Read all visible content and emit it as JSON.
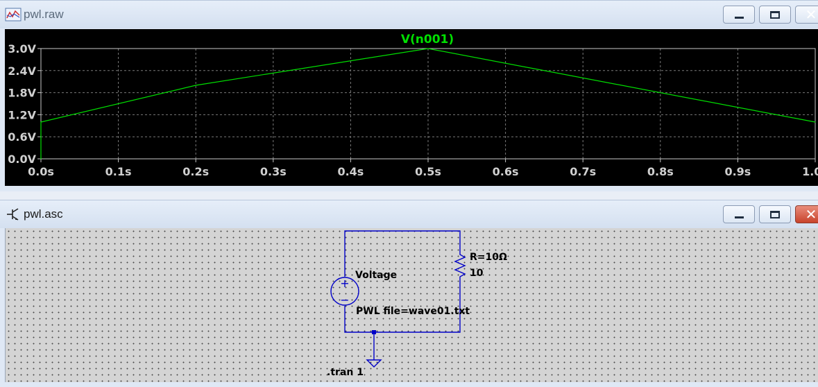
{
  "windows": {
    "raw": {
      "title": "pwl.raw",
      "buttons": {
        "minimize": "minimize",
        "maximize": "maximize",
        "close": "close"
      }
    },
    "asc": {
      "title": "pwl.asc",
      "buttons": {
        "minimize": "minimize",
        "maximize": "maximize",
        "close": "close"
      }
    }
  },
  "chart_data": {
    "type": "line",
    "title": "V(n001)",
    "xlabel": "",
    "ylabel": "",
    "xlim": [
      0,
      1.0
    ],
    "ylim": [
      0,
      3.0
    ],
    "grid": true,
    "x_ticks": [
      {
        "value": 0.0,
        "label": "0.0s"
      },
      {
        "value": 0.1,
        "label": "0.1s"
      },
      {
        "value": 0.2,
        "label": "0.2s"
      },
      {
        "value": 0.3,
        "label": "0.3s"
      },
      {
        "value": 0.4,
        "label": "0.4s"
      },
      {
        "value": 0.5,
        "label": "0.5s"
      },
      {
        "value": 0.6,
        "label": "0.6s"
      },
      {
        "value": 0.7,
        "label": "0.7s"
      },
      {
        "value": 0.8,
        "label": "0.8s"
      },
      {
        "value": 0.9,
        "label": "0.9s"
      },
      {
        "value": 1.0,
        "label": "1.0s"
      }
    ],
    "y_ticks": [
      {
        "value": 0.0,
        "label": "0.0V"
      },
      {
        "value": 0.6,
        "label": "0.6V"
      },
      {
        "value": 1.2,
        "label": "1.2V"
      },
      {
        "value": 1.8,
        "label": "1.8V"
      },
      {
        "value": 2.4,
        "label": "2.4V"
      },
      {
        "value": 3.0,
        "label": "3.0V"
      }
    ],
    "series": [
      {
        "name": "V(n001)",
        "color": "#00e000",
        "x": [
          0.0,
          0.0,
          0.2,
          0.5,
          1.0
        ],
        "y": [
          0.0,
          1.0,
          2.0,
          3.0,
          1.0
        ]
      }
    ]
  },
  "schematic": {
    "source_label": "Voltage",
    "source_value": "PWL file=wave01.txt",
    "resistor_name": "R=10Ω",
    "resistor_value": "10",
    "directive": ".tran 1",
    "wire_color": "#0000c8"
  },
  "colors": {
    "plot_bg": "#000000",
    "axis": "#c8c8c8",
    "grid": "#7a7a7a",
    "tick_text": "#d0d0d0",
    "trace": "#00e000",
    "component": "#0000c8"
  }
}
